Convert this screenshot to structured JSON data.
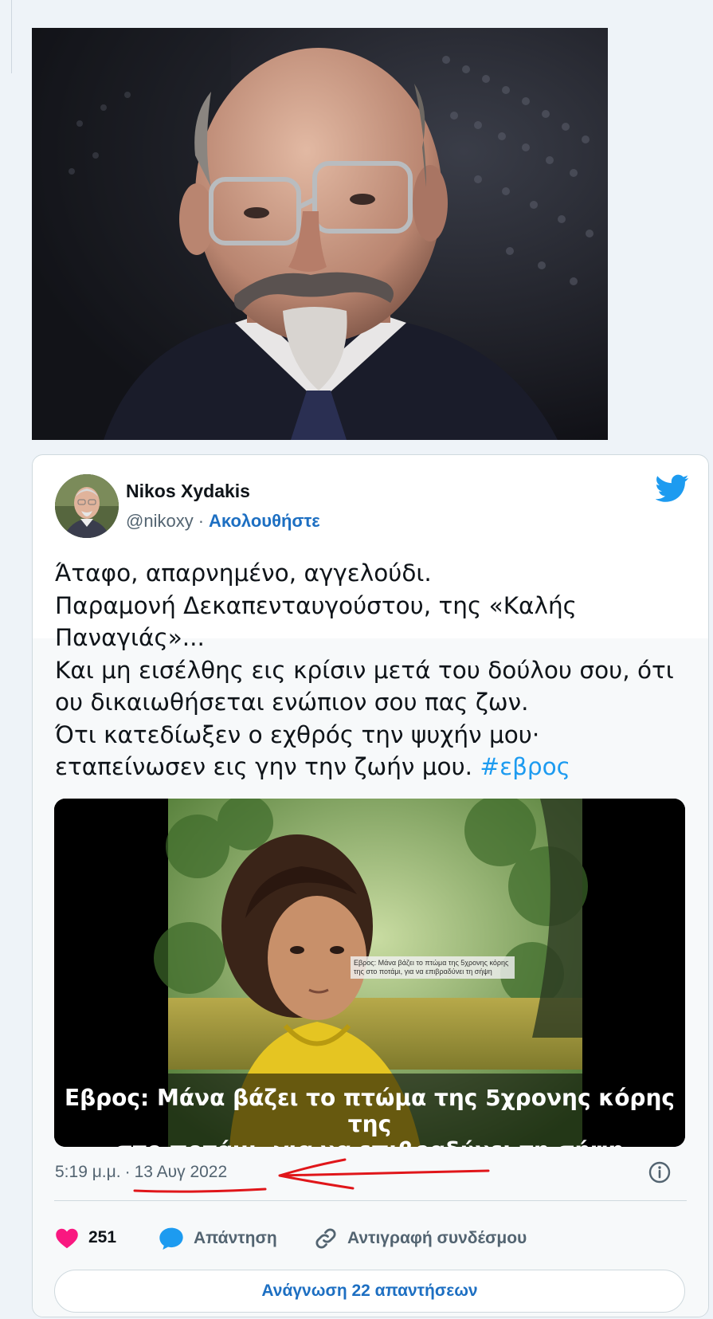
{
  "tweet": {
    "author": {
      "name": "Nikos Xydakis",
      "handle": "@nikoxy",
      "separator": "·",
      "follow_label": "Ακολουθήστε"
    },
    "text_lines": [
      "Άταφο, απαρνημένο, αγγελούδι.",
      "Παραμονή Δεκαπενταυγούστου, της «Καλής",
      "Παναγιάς»...",
      "Και μη εισέλθης εις κρίσιν μετά του δούλου σου, ότι",
      "ου δικαιωθήσεται ενώπιον σου πας ζων.",
      "Ότι κατεδίωξεν ο εχθρός την ψυχήν μου·"
    ],
    "last_line_text": "εταπείνωσεν εις γην την ζωήν μου.",
    "hashtag": "#εβρος",
    "media": {
      "overlay_text": "Εβρος: Μάνα βάζει το πτώμα της 5χρονης κόρης της στο ποτάμι, για να επιβραδύνει τη σήψη",
      "caption_line1": "Εβρος: Μάνα βάζει το πτώμα της 5χρονης κόρης της",
      "caption_line2": "στο ποτάμι, για να επιβραδύνει τη σήψη"
    },
    "time": "5:19 μ.μ.",
    "time_separator": "·",
    "date": "13 Αυγ 2022",
    "actions": {
      "likes_count": "251",
      "reply_label": "Απάντηση",
      "copy_link_label": "Αντιγραφή συνδέσμου"
    },
    "read_replies_label": "Ανάγνωση 22 απαντήσεων"
  },
  "colors": {
    "link_blue": "#1d6fc2",
    "hashtag_blue": "#1d9bf0",
    "like_pink": "#f91880",
    "annotation_red": "#e0161a",
    "twitter_blue": "#1d9bf0"
  },
  "icons": [
    "twitter-bird-icon",
    "info-icon",
    "heart-icon",
    "reply-bubble-icon",
    "link-icon"
  ]
}
